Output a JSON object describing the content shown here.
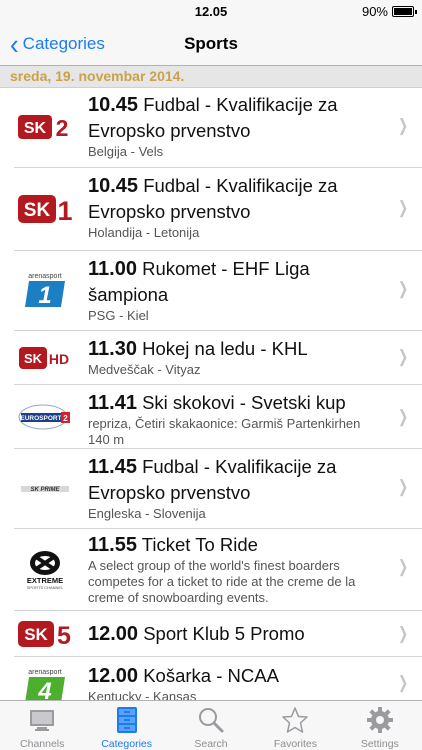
{
  "status_bar": {
    "time": "12.05",
    "battery": "90%",
    "battery_level": 0.9
  },
  "nav": {
    "back_label": "Categories",
    "title": "Sports"
  },
  "date_header": "sreda, 19. novembar 2014.",
  "events": [
    {
      "channel": "SK 2",
      "channel_icon": "sport-klub-2-logo",
      "time": "10.45",
      "title": "Fudbal - Kvalifikacije za",
      "title2": "Evropsko prvenstvo",
      "subtitle": "Belgija - Vels",
      "subtitle2": ""
    },
    {
      "channel": "SK 1",
      "channel_icon": "sport-klub-1-logo",
      "time": "10.45",
      "title": "Fudbal - Kvalifikacije za",
      "title2": "Evropsko prvenstvo",
      "subtitle": "Holandija - Letonija",
      "subtitle2": ""
    },
    {
      "channel": "arenasport 1",
      "channel_icon": "arenasport-1-logo",
      "time": "11.00",
      "title": "Rukomet - EHF Liga",
      "title2": "šampiona",
      "subtitle": "PSG - Kiel",
      "subtitle2": ""
    },
    {
      "channel": "SK HD",
      "channel_icon": "sport-klub-hd-logo",
      "time": "11.30",
      "title": "Hokej na ledu - KHL",
      "title2": "",
      "subtitle": "Medveščak - Vityaz",
      "subtitle2": ""
    },
    {
      "channel": "EUROSPORT 2",
      "channel_icon": "eurosport-2-logo",
      "time": "11.41",
      "title": "Ski skokovi - Svetski kup",
      "title2": "",
      "subtitle": "repriza, Četiri skakaonice: Garmiš Partenkirhen",
      "subtitle2": "140 m"
    },
    {
      "channel": "SK PRIME",
      "channel_icon": "sport-klub-prime-logo",
      "time": "11.45",
      "title": "Fudbal - Kvalifikacije za",
      "title2": "Evropsko prvenstvo",
      "subtitle": "Engleska - Slovenija",
      "subtitle2": ""
    },
    {
      "channel": "EXTREME",
      "channel_icon": "extreme-sports-logo",
      "time": "11.55",
      "title": "Ticket To Ride",
      "title2": "",
      "subtitle": "A select group of the world's finest boarders",
      "subtitle2": "competes for a ticket to ride at the creme de la",
      "subtitle3": "creme of snowboarding events."
    },
    {
      "channel": "SK 5",
      "channel_icon": "sport-klub-5-logo",
      "time": "12.00",
      "title": "Sport Klub 5 Promo",
      "title2": "",
      "subtitle": "",
      "subtitle2": ""
    },
    {
      "channel": "arenasport 4",
      "channel_icon": "arenasport-4-logo",
      "time": "12.00",
      "title": "Košarka - NCAA",
      "title2": "",
      "subtitle": "Kentucky - Kansas",
      "subtitle2": ""
    }
  ],
  "logo_text": {
    "sk": "SK",
    "sk2": "2",
    "sk1": "1",
    "skhd": "HD",
    "sk5": "5",
    "arena": "arenasport",
    "arena1": "1",
    "arena4": "4",
    "euro": "EUROSPORT",
    "euro2": "2",
    "prime": "SK PRIME",
    "extreme": "EXTREME",
    "extreme_sub": "SPORTS CHANNEL"
  },
  "tabs": [
    {
      "label": "Channels",
      "icon": "tv-icon"
    },
    {
      "label": "Categories",
      "icon": "cabinet-icon",
      "active": true
    },
    {
      "label": "Search",
      "icon": "search-icon"
    },
    {
      "label": "Favorites",
      "icon": "star-icon"
    },
    {
      "label": "Settings",
      "icon": "gear-icon"
    }
  ],
  "colors": {
    "accent": "#1a7bf2",
    "date_header_text": "#c9a34a",
    "sk_red": "#b3191f",
    "arena_blue": "#1c7fc4",
    "arena_green": "#4caf2e"
  }
}
